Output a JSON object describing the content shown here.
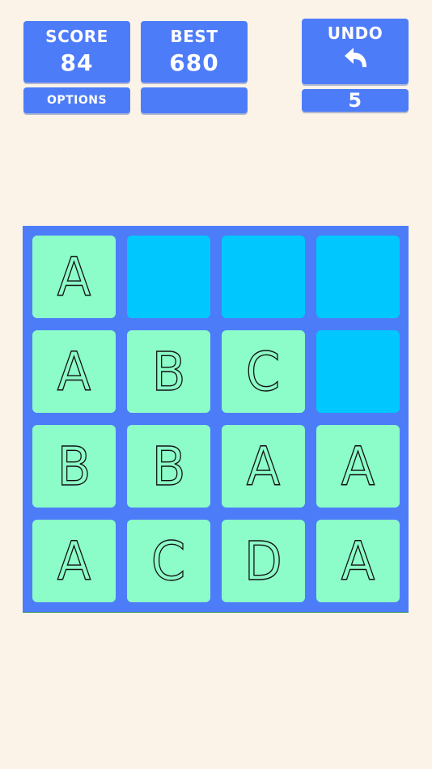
{
  "score": {
    "label": "SCORE",
    "value": "84"
  },
  "best": {
    "label": "BEST",
    "value": "680"
  },
  "options": {
    "label": "OPTIONS"
  },
  "undo": {
    "label": "UNDO",
    "icon": "undo-arrow-icon",
    "remaining": "5"
  },
  "colors": {
    "background": "#fbf3e8",
    "panel": "#4d7cf9",
    "empty_cell": "#00c8ff",
    "tile": "#8cfcc8"
  },
  "board": {
    "rows": [
      [
        "A",
        "",
        "",
        ""
      ],
      [
        "A",
        "B",
        "C",
        ""
      ],
      [
        "B",
        "B",
        "A",
        "A"
      ],
      [
        "A",
        "C",
        "D",
        "A"
      ]
    ]
  }
}
